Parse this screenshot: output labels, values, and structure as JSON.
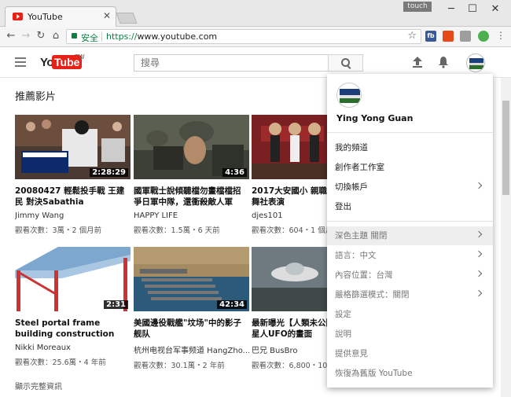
{
  "browser": {
    "tab_title": "YouTube",
    "touch_label": "touch",
    "secure_label": "安全",
    "url_scheme": "https://",
    "url_rest": "www.youtube.com",
    "extensions": [
      {
        "name": "fb",
        "color": "#3b5998"
      },
      {
        "name": "",
        "color": "#e64a19"
      },
      {
        "name": "",
        "color": "#9e9e9e"
      },
      {
        "name": "",
        "color": "#4caf50"
      }
    ]
  },
  "header": {
    "logo_you": "You",
    "logo_tube": "Tube",
    "logo_region": "TW",
    "search_placeholder": "搜尋"
  },
  "main": {
    "section_title": "推薦影片",
    "more_info": "顯示完整資訊",
    "videos": [
      {
        "title": "20080427 輕鬆投手戰 王建民 對決Sabathia",
        "channel": "Jimmy Wang",
        "meta": "觀看次數：3萬・2 個月前",
        "duration": "2:28:29"
      },
      {
        "title": "國軍戰士說傾聽檔勿畫檔檔招 爭日軍中隊，還衝殺敵人軍",
        "channel": "HAPPY LIFE",
        "meta": "觀看次數：1.5萬・6 天前",
        "duration": "4:36"
      },
      {
        "title": "2017大安國小 親職教育日 熱舞社表演",
        "channel": "djes101",
        "meta": "觀看次數：604・1 個月前",
        "duration": ""
      },
      {
        "title": "Steel portal frame building construction",
        "channel": "Nikki Moreaux",
        "meta": "觀看次數：25.6萬・4 年前",
        "duration": "2:31"
      },
      {
        "title": "美國邊役戰艦\"坟场\"中的影子 舰队",
        "channel": "杭州电视台军事频道 HangZho...",
        "meta": "觀看次數：30.1萬・2 年前",
        "duration": "42:34"
      },
      {
        "title": "最新曝光【人類未公開】證實外星人UFO的畫面",
        "channel": "巴兄 BusBro",
        "meta": "觀看次數：6,800・10 個月前",
        "duration": ""
      }
    ]
  },
  "menu": {
    "user_name": "Ying Yong Guan",
    "items_primary": [
      {
        "label": "我的頻道",
        "chevron": false
      },
      {
        "label": "創作者工作室",
        "chevron": false
      },
      {
        "label": "切換帳戶",
        "chevron": true
      },
      {
        "label": "登出",
        "chevron": false
      }
    ],
    "items_settings": [
      {
        "label": "深色主題 關閉",
        "chevron": true
      },
      {
        "label": "語言：中文",
        "chevron": true
      },
      {
        "label": "內容位置：台灣",
        "chevron": true
      },
      {
        "label": "嚴格篩選模式：關閉",
        "chevron": true
      },
      {
        "label": "設定",
        "chevron": false
      },
      {
        "label": "說明",
        "chevron": false
      },
      {
        "label": "提供意見",
        "chevron": false
      },
      {
        "label": "恢復為舊版 YouTube",
        "chevron": false
      }
    ]
  }
}
